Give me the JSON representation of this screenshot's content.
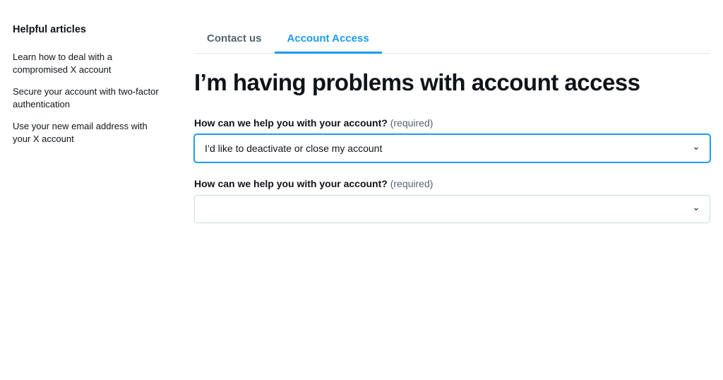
{
  "sidebar": {
    "title": "Helpful articles",
    "items": [
      {
        "label": "Learn how to deal with a compromised X account"
      },
      {
        "label": "Secure your account with two-factor authentication"
      },
      {
        "label": "Use your new email address with your X account"
      }
    ]
  },
  "tabs": [
    {
      "label": "Contact us",
      "active": false
    },
    {
      "label": "Account Access",
      "active": true
    }
  ],
  "main": {
    "title": "I’m having problems with account access"
  },
  "fields": [
    {
      "label": "How can we help you with your account?",
      "required_text": "(required)",
      "value": "I’d like to deactivate or close my account",
      "focused": true
    },
    {
      "label": "How can we help you with your account?",
      "required_text": "(required)",
      "value": "",
      "focused": false
    }
  ]
}
